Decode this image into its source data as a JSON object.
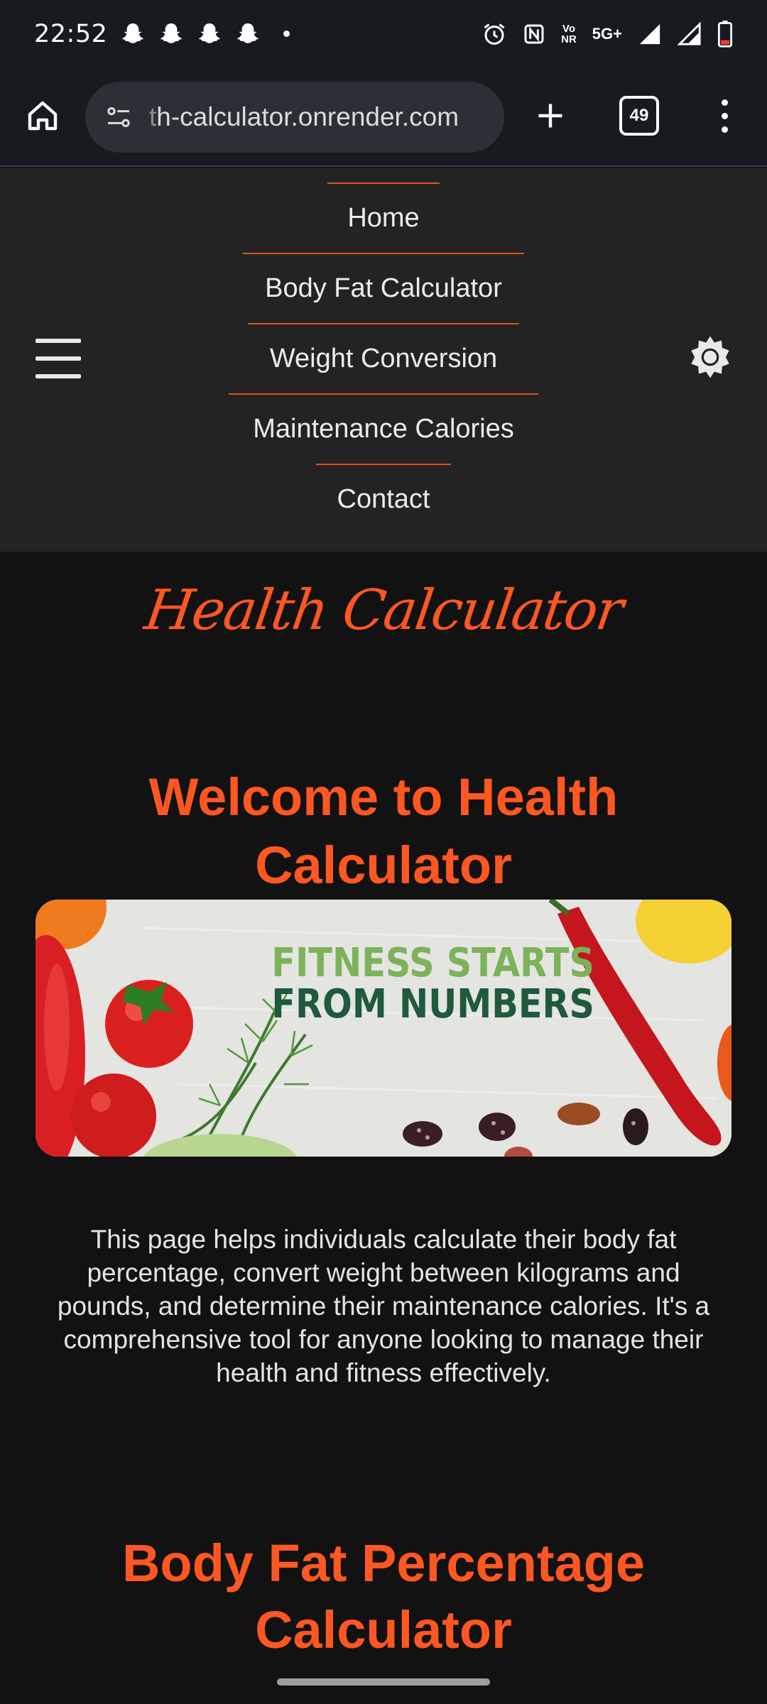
{
  "status_bar": {
    "time": "22:52",
    "network_label_top": "Vo",
    "network_label_bottom": "NR",
    "network_type": "5G+"
  },
  "browser": {
    "url_faded": "t",
    "url": "h-calculator.onrender.com",
    "tab_count": "49"
  },
  "nav": {
    "items": [
      {
        "label": "Home"
      },
      {
        "label": "Body Fat Calculator"
      },
      {
        "label": "Weight Conversion"
      },
      {
        "label": "Maintenance Calories"
      },
      {
        "label": "Contact"
      }
    ]
  },
  "main": {
    "logo": "Health Calculator",
    "welcome_title": "Welcome to Health Calculator",
    "hero_line1": "FITNESS STARTS",
    "hero_line2": "FROM NUMBERS",
    "intro": "This page helps individuals calculate their body fat percentage, convert weight between kilograms and pounds, and determine their maintenance calories. It's a comprehensive tool for anyone looking to manage their health and fitness effectively.",
    "section_title": "Body Fat Percentage Calculator"
  },
  "colors": {
    "accent": "#ff5722",
    "nav_divider": "#e0541f",
    "background": "#121212",
    "header_bg": "#232323"
  },
  "icons": [
    "snapchat-ghost-icon",
    "alarm-icon",
    "nfc-icon",
    "signal-icon",
    "battery-icon",
    "home-icon",
    "site-info-icon",
    "plus-icon",
    "tabs-icon",
    "more-vert-icon",
    "hamburger-menu-icon",
    "sun-icon"
  ]
}
